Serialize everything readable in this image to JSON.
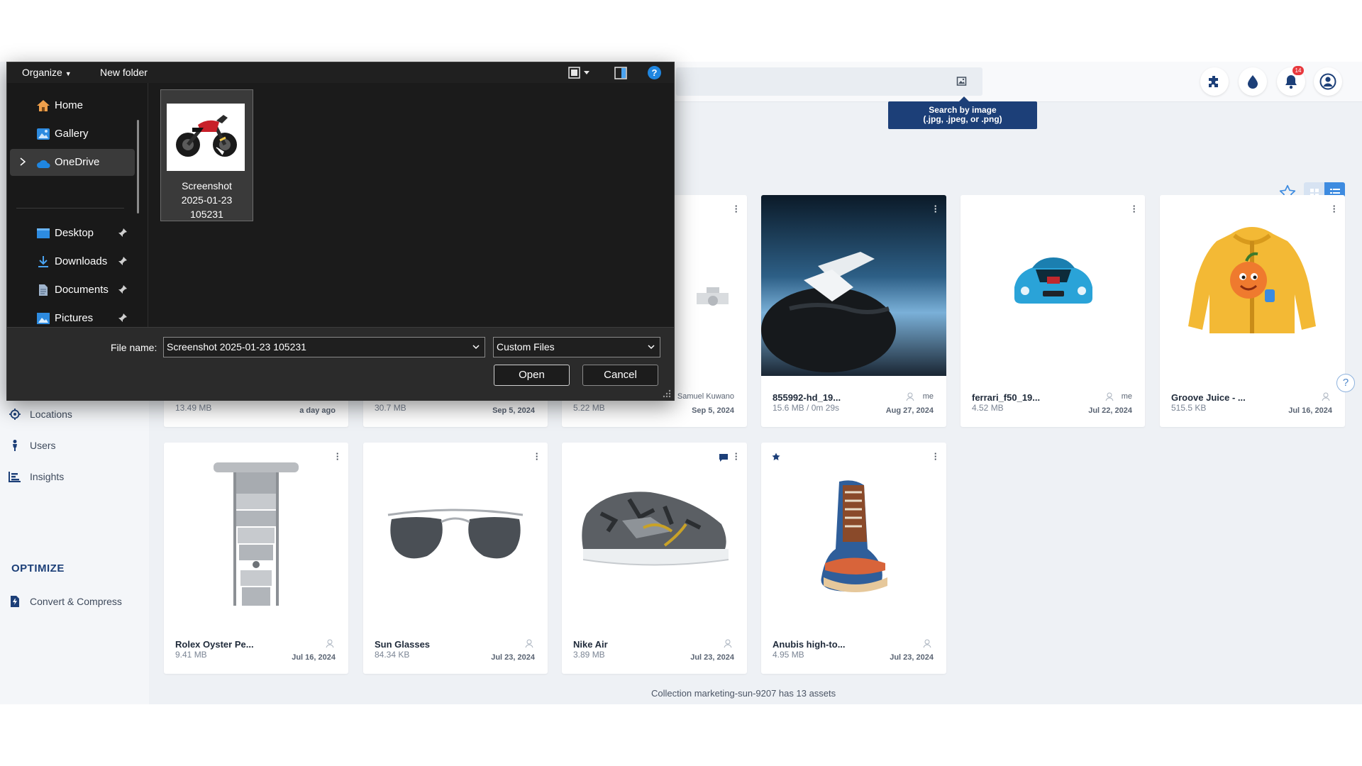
{
  "dialog": {
    "toolbar": {
      "organize_label": "Organize",
      "new_folder_label": "New folder"
    },
    "nav": [
      {
        "label": "Home",
        "icon": "home-icon",
        "pinned": false
      },
      {
        "label": "Gallery",
        "icon": "gallery-icon",
        "pinned": false
      },
      {
        "label": "OneDrive",
        "icon": "cloud-icon",
        "pinned": false,
        "selected": true
      },
      {
        "label": "Desktop",
        "icon": "desktop-folder-icon",
        "pinned": true
      },
      {
        "label": "Downloads",
        "icon": "download-icon",
        "pinned": true
      },
      {
        "label": "Documents",
        "icon": "documents-icon",
        "pinned": true
      },
      {
        "label": "Pictures",
        "icon": "pictures-icon",
        "pinned": true
      }
    ],
    "file": {
      "label": "Screenshot 2025-01-23 105231",
      "icon": "motorcycle-thumbnail"
    },
    "file_name_label": "File name:",
    "file_name_value": "Screenshot 2025-01-23 105231",
    "file_type_value": "Custom Files",
    "open_label": "Open",
    "cancel_label": "Cancel",
    "accent": "#0078d4"
  },
  "app": {
    "tooltip": {
      "line1": "Search by image",
      "line2": "(.jpg, .jpeg, or .png)"
    },
    "notifications_count": "14",
    "sidebar": {
      "items": [
        {
          "label": "Locations",
          "icon": "location-icon"
        },
        {
          "label": "Users",
          "icon": "user-icon"
        },
        {
          "label": "Insights",
          "icon": "chart-icon"
        }
      ],
      "optimize_heading": "OPTIMIZE",
      "optimize_items": [
        {
          "label": "Convert & Compress",
          "icon": "convert-icon"
        }
      ]
    },
    "row1_partial": [
      {
        "size": "13.49 MB",
        "date": "a day ago"
      },
      {
        "size": "30.7 MB",
        "date": "Sep 5, 2024"
      },
      {
        "size": "5.22 MB",
        "owner": "Samuel Kuwano",
        "date": "Sep 5, 2024"
      }
    ],
    "row1_cards": [
      {
        "title": "855992-hd_19...",
        "size": "15.6 MB / 0m 29s",
        "owner": "me",
        "date": "Aug 27, 2024"
      },
      {
        "title": "ferrari_f50_19...",
        "size": "4.52 MB",
        "owner": "me",
        "date": "Jul 22, 2024"
      },
      {
        "title": "Groove Juice - ...",
        "size": "515.5 KB",
        "owner": "",
        "date": "Jul 16, 2024"
      }
    ],
    "row2_cards": [
      {
        "title": "Rolex Oyster Pe...",
        "size": "9.41 MB",
        "date": "Jul 16, 2024"
      },
      {
        "title": "Sun Glasses",
        "size": "84.34 KB",
        "date": "Jul 23, 2024"
      },
      {
        "title": "Nike Air",
        "size": "3.89 MB",
        "date": "Jul 23, 2024"
      },
      {
        "title": "Anubis high-to...",
        "size": "4.95 MB",
        "date": "Jul 23, 2024"
      }
    ],
    "collection_summary": "Collection marketing-sun-9207 has 13 assets",
    "accent": "#3d8be0",
    "brand_dark": "#1c3f78"
  }
}
